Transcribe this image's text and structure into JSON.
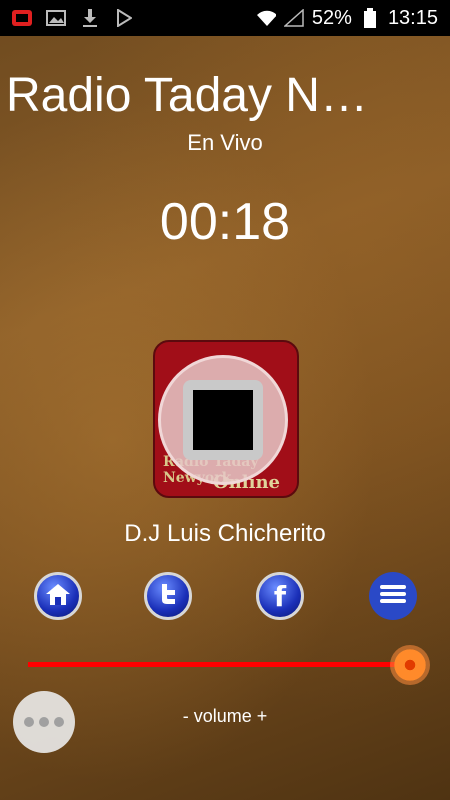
{
  "status_bar": {
    "battery": "52%",
    "time": "13:15",
    "icons": [
      "notification-app-icon",
      "image-icon",
      "download-icon",
      "play-store-icon",
      "wifi-icon",
      "signal-icon",
      "battery-icon"
    ]
  },
  "station": {
    "title": "Radio Taday N…",
    "subtitle": "En Vivo",
    "elapsed": "00:18",
    "artwork_line1": "Radio Taday Newyork",
    "artwork_line2": "Online",
    "dj": "D.J Luis Chicherito"
  },
  "social": [
    "home-icon",
    "twitter-icon",
    "facebook-icon",
    "menu-icon"
  ],
  "volume": {
    "label": "- volume +",
    "level": 0.97,
    "track_color": "#ff0000"
  }
}
